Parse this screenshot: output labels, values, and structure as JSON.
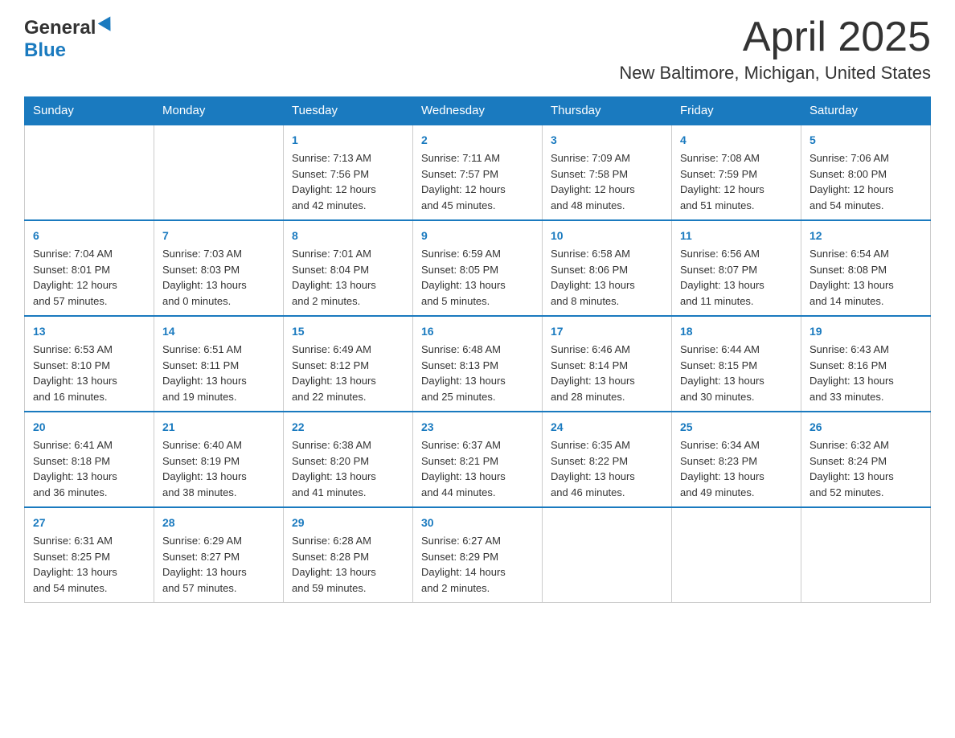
{
  "header": {
    "logo_line1": "General",
    "logo_line2": "Blue",
    "month_title": "April 2025",
    "location": "New Baltimore, Michigan, United States"
  },
  "weekdays": [
    "Sunday",
    "Monday",
    "Tuesday",
    "Wednesday",
    "Thursday",
    "Friday",
    "Saturday"
  ],
  "weeks": [
    [
      {
        "day": "",
        "info": ""
      },
      {
        "day": "",
        "info": ""
      },
      {
        "day": "1",
        "info": "Sunrise: 7:13 AM\nSunset: 7:56 PM\nDaylight: 12 hours\nand 42 minutes."
      },
      {
        "day": "2",
        "info": "Sunrise: 7:11 AM\nSunset: 7:57 PM\nDaylight: 12 hours\nand 45 minutes."
      },
      {
        "day": "3",
        "info": "Sunrise: 7:09 AM\nSunset: 7:58 PM\nDaylight: 12 hours\nand 48 minutes."
      },
      {
        "day": "4",
        "info": "Sunrise: 7:08 AM\nSunset: 7:59 PM\nDaylight: 12 hours\nand 51 minutes."
      },
      {
        "day": "5",
        "info": "Sunrise: 7:06 AM\nSunset: 8:00 PM\nDaylight: 12 hours\nand 54 minutes."
      }
    ],
    [
      {
        "day": "6",
        "info": "Sunrise: 7:04 AM\nSunset: 8:01 PM\nDaylight: 12 hours\nand 57 minutes."
      },
      {
        "day": "7",
        "info": "Sunrise: 7:03 AM\nSunset: 8:03 PM\nDaylight: 13 hours\nand 0 minutes."
      },
      {
        "day": "8",
        "info": "Sunrise: 7:01 AM\nSunset: 8:04 PM\nDaylight: 13 hours\nand 2 minutes."
      },
      {
        "day": "9",
        "info": "Sunrise: 6:59 AM\nSunset: 8:05 PM\nDaylight: 13 hours\nand 5 minutes."
      },
      {
        "day": "10",
        "info": "Sunrise: 6:58 AM\nSunset: 8:06 PM\nDaylight: 13 hours\nand 8 minutes."
      },
      {
        "day": "11",
        "info": "Sunrise: 6:56 AM\nSunset: 8:07 PM\nDaylight: 13 hours\nand 11 minutes."
      },
      {
        "day": "12",
        "info": "Sunrise: 6:54 AM\nSunset: 8:08 PM\nDaylight: 13 hours\nand 14 minutes."
      }
    ],
    [
      {
        "day": "13",
        "info": "Sunrise: 6:53 AM\nSunset: 8:10 PM\nDaylight: 13 hours\nand 16 minutes."
      },
      {
        "day": "14",
        "info": "Sunrise: 6:51 AM\nSunset: 8:11 PM\nDaylight: 13 hours\nand 19 minutes."
      },
      {
        "day": "15",
        "info": "Sunrise: 6:49 AM\nSunset: 8:12 PM\nDaylight: 13 hours\nand 22 minutes."
      },
      {
        "day": "16",
        "info": "Sunrise: 6:48 AM\nSunset: 8:13 PM\nDaylight: 13 hours\nand 25 minutes."
      },
      {
        "day": "17",
        "info": "Sunrise: 6:46 AM\nSunset: 8:14 PM\nDaylight: 13 hours\nand 28 minutes."
      },
      {
        "day": "18",
        "info": "Sunrise: 6:44 AM\nSunset: 8:15 PM\nDaylight: 13 hours\nand 30 minutes."
      },
      {
        "day": "19",
        "info": "Sunrise: 6:43 AM\nSunset: 8:16 PM\nDaylight: 13 hours\nand 33 minutes."
      }
    ],
    [
      {
        "day": "20",
        "info": "Sunrise: 6:41 AM\nSunset: 8:18 PM\nDaylight: 13 hours\nand 36 minutes."
      },
      {
        "day": "21",
        "info": "Sunrise: 6:40 AM\nSunset: 8:19 PM\nDaylight: 13 hours\nand 38 minutes."
      },
      {
        "day": "22",
        "info": "Sunrise: 6:38 AM\nSunset: 8:20 PM\nDaylight: 13 hours\nand 41 minutes."
      },
      {
        "day": "23",
        "info": "Sunrise: 6:37 AM\nSunset: 8:21 PM\nDaylight: 13 hours\nand 44 minutes."
      },
      {
        "day": "24",
        "info": "Sunrise: 6:35 AM\nSunset: 8:22 PM\nDaylight: 13 hours\nand 46 minutes."
      },
      {
        "day": "25",
        "info": "Sunrise: 6:34 AM\nSunset: 8:23 PM\nDaylight: 13 hours\nand 49 minutes."
      },
      {
        "day": "26",
        "info": "Sunrise: 6:32 AM\nSunset: 8:24 PM\nDaylight: 13 hours\nand 52 minutes."
      }
    ],
    [
      {
        "day": "27",
        "info": "Sunrise: 6:31 AM\nSunset: 8:25 PM\nDaylight: 13 hours\nand 54 minutes."
      },
      {
        "day": "28",
        "info": "Sunrise: 6:29 AM\nSunset: 8:27 PM\nDaylight: 13 hours\nand 57 minutes."
      },
      {
        "day": "29",
        "info": "Sunrise: 6:28 AM\nSunset: 8:28 PM\nDaylight: 13 hours\nand 59 minutes."
      },
      {
        "day": "30",
        "info": "Sunrise: 6:27 AM\nSunset: 8:29 PM\nDaylight: 14 hours\nand 2 minutes."
      },
      {
        "day": "",
        "info": ""
      },
      {
        "day": "",
        "info": ""
      },
      {
        "day": "",
        "info": ""
      }
    ]
  ]
}
